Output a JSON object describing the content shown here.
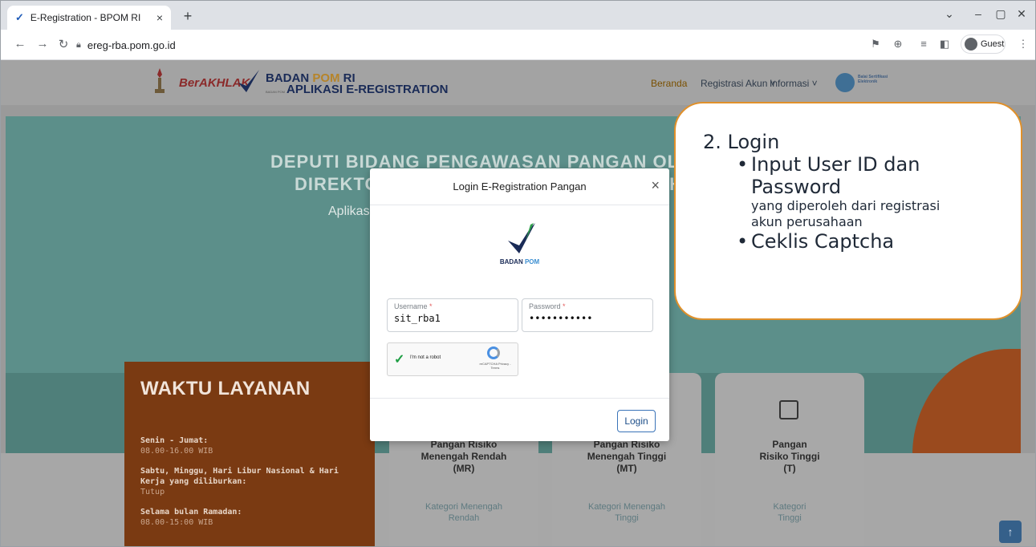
{
  "browser": {
    "tab_title": "E-Registration - BPOM RI",
    "url": "ereg-rba.pom.go.id",
    "guest_label": "Guest"
  },
  "site": {
    "berakhlak": "BerAKHLAK",
    "logo_line1_a": "BADAN ",
    "logo_line1_b": "POM",
    "logo_line1_c": " RI",
    "logo_line2": "APLIKASI E-REGISTRATION",
    "logo_line2_prefix": "BADAN POM",
    "nav": {
      "beranda": "Beranda",
      "registrasi": "Registrasi Akun ˅",
      "informasi": "Informasi ˅"
    },
    "bsre_text": "Balai Sertifikasi Elektronik"
  },
  "hero": {
    "line1": "DEPUTI BIDANG PENGAWASAN PANGAN OLAHAN",
    "line2": "DIREKTORAT REGISTRASI PANGAN OLAHAN",
    "sub": "Aplikasi E-Registration Pangan Olahan"
  },
  "waktu": {
    "title": "WAKTU LAYANAN",
    "label1": "Senin - Jumat:",
    "value1": "08.00-16.00 WIB",
    "label2": "Sabtu, Minggu, Hari Libur Nasional & Hari Kerja yang diliburkan:",
    "value2": "Tutup",
    "label3": "Selama bulan Ramadan:",
    "value3": "08.00-15:00 WIB"
  },
  "cards": [
    {
      "name": "Pangan Risiko Menengah Rendah (MR)",
      "category": "Kategori Menengah Rendah"
    },
    {
      "name": "Pangan Risiko Menengah Tinggi (MT)",
      "category": "Kategori Menengah Tinggi"
    },
    {
      "name": "Pangan Risiko Tinggi (T)",
      "category": "Kategori Tinggi"
    }
  ],
  "modal": {
    "title": "Login E-Registration Pangan",
    "close": "×",
    "logo_text_a": "BADAN ",
    "logo_text_b": "POM",
    "username_label": "Username",
    "username_value": "sit_rba1",
    "password_label": "Password",
    "password_value": "•••••••••••",
    "required_mark": "*",
    "captcha_label": "I'm not a robot",
    "captcha_brand": "reCAPTCHA Privacy - Terms",
    "login_button": "Login"
  },
  "callout": {
    "step": "2.  Login",
    "bullet1_line1": "Input User ID dan",
    "bullet1_line2": "Password",
    "small1": "yang diperoleh dari registrasi",
    "small2": "akun perusahaan",
    "bullet2": "Ceklis Captcha"
  },
  "colors": {
    "accent_orange": "#e0902a",
    "login_blue": "#3a73b8",
    "waktu_bg": "#7a3a12"
  }
}
